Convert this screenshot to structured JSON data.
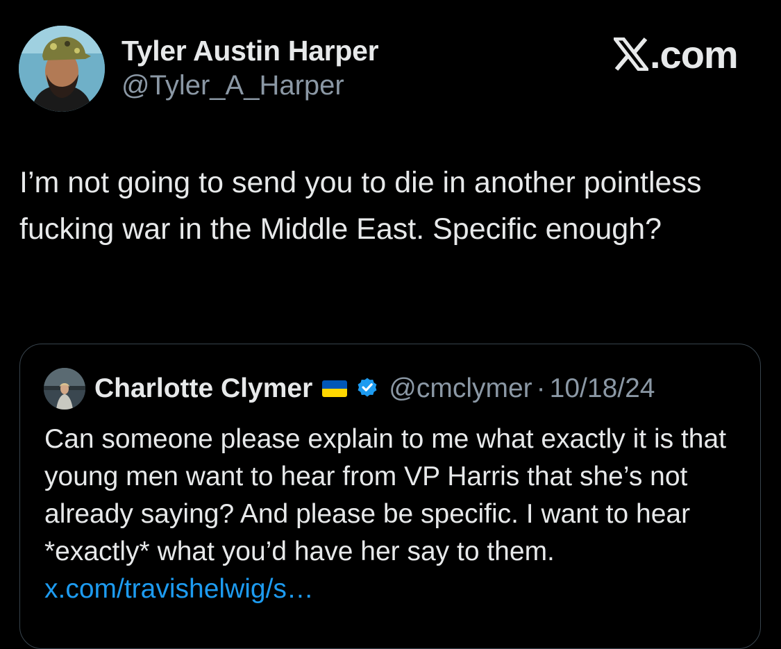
{
  "author": {
    "name": "Tyler Austin Harper",
    "handle": "@Tyler_A_Harper"
  },
  "brand": {
    "label": ".com",
    "logo_icon": "x-logo-icon"
  },
  "tweet": {
    "text": "I’m not going to send you to die in another pointless fucking war in the Middle East. Specific enough?"
  },
  "quoted_tweet": {
    "name": "Charlotte Clymer",
    "flag_icon": "ukraine-flag-icon",
    "verified_icon": "verified-badge-icon",
    "handle": "@cmclymer",
    "separator": "·",
    "date": "10/18/24",
    "text": "Can someone please explain to me what exactly it is that young men want to hear from VP Harris that she’s not already saying? And please be specific. I want to hear *exactly* what you’d have her say to them.",
    "link": "x.com/travishelwig/s…"
  },
  "colors": {
    "background": "#000000",
    "primary_text": "#e7e9ea",
    "secondary_text": "#8b98a5",
    "link": "#1d9bf0",
    "verified": "#1d9bf0",
    "border": "#38444d"
  }
}
